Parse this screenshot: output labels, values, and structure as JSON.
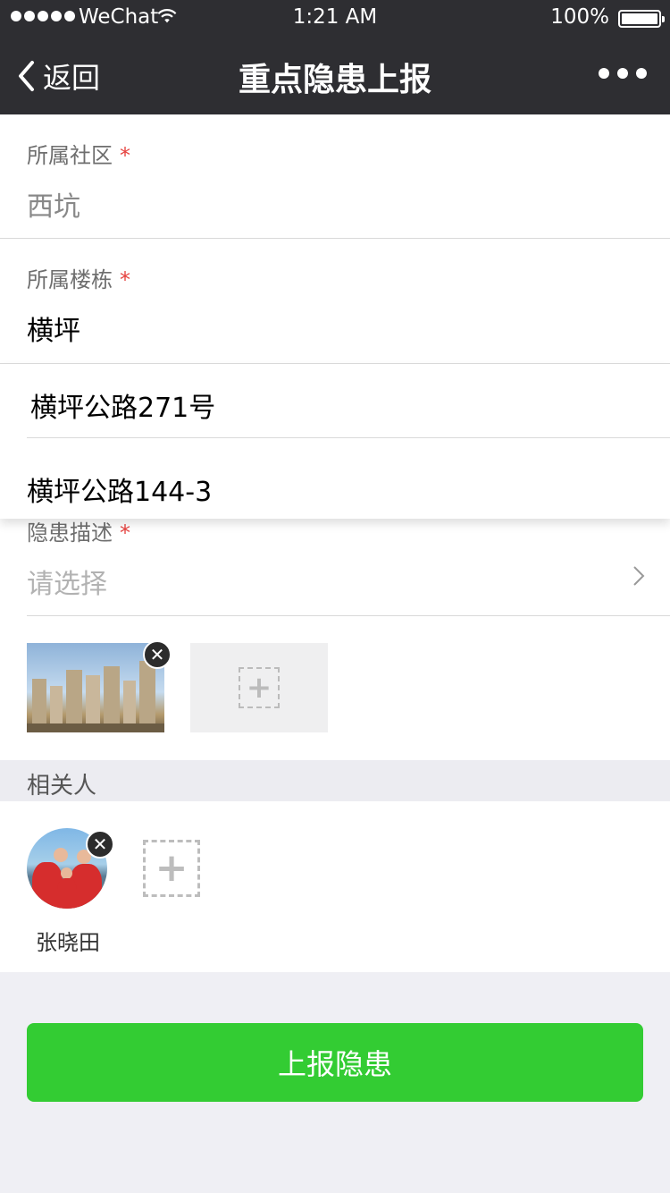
{
  "status_bar": {
    "carrier": "WeChat",
    "time": "1:21 AM",
    "battery": "100%"
  },
  "nav": {
    "back_label": "返回",
    "title": "重点隐患上报"
  },
  "form": {
    "community": {
      "label": "所属社区",
      "required_mark": "*",
      "value": "西坑"
    },
    "building": {
      "label": "所属楼栋",
      "required_mark": "*",
      "value": "横坪"
    },
    "description": {
      "label": "隐患描述",
      "required_mark": "*",
      "placeholder": "请选择"
    }
  },
  "dropdown": {
    "options": [
      "横坪公路271号",
      "横坪公路144-3"
    ]
  },
  "related": {
    "header": "相关人",
    "people": [
      {
        "name": "张晓田"
      }
    ]
  },
  "submit_label": "上报隐患",
  "colors": {
    "nav_bg": "#2e2e32",
    "required": "#e64340",
    "submit_bg": "#33cc33"
  }
}
